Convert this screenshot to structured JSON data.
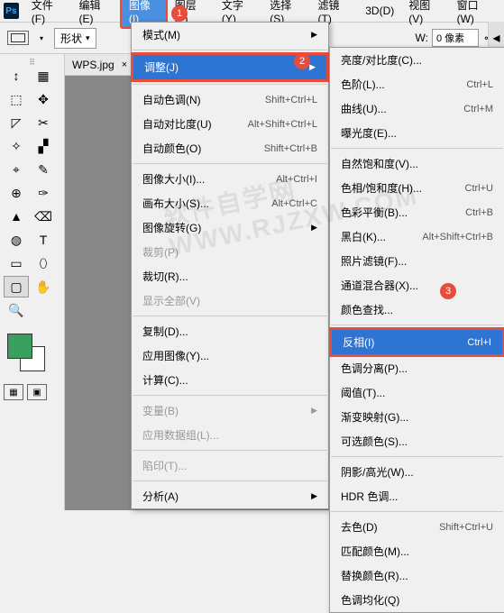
{
  "menubar": {
    "items": [
      "文件(F)",
      "编辑(E)",
      "图像(I)",
      "图层(L)",
      "文字(Y)",
      "选择(S)",
      "滤镜(T)",
      "3D(D)",
      "视图(V)",
      "窗口(W)"
    ],
    "active_index": 2
  },
  "optionbar": {
    "shape_label": "形状",
    "w_label": "W:",
    "w_value": "0 像素",
    "link": "⊶"
  },
  "tab": {
    "title": "WPS.jpg",
    "close": "×"
  },
  "badges": {
    "b1": "1",
    "b2": "2",
    "b3": "3"
  },
  "dropdown1": [
    {
      "label": "模式(M)",
      "arrow": true
    },
    {
      "sep": true
    },
    {
      "label": "调整(J)",
      "arrow": true,
      "selected": true,
      "highlighted": true
    },
    {
      "sep": true
    },
    {
      "label": "自动色调(N)",
      "shortcut": "Shift+Ctrl+L"
    },
    {
      "label": "自动对比度(U)",
      "shortcut": "Alt+Shift+Ctrl+L"
    },
    {
      "label": "自动颜色(O)",
      "shortcut": "Shift+Ctrl+B"
    },
    {
      "sep": true
    },
    {
      "label": "图像大小(I)...",
      "shortcut": "Alt+Ctrl+I"
    },
    {
      "label": "画布大小(S)...",
      "shortcut": "Alt+Ctrl+C"
    },
    {
      "label": "图像旋转(G)",
      "arrow": true
    },
    {
      "label": "裁剪(P)",
      "disabled": true
    },
    {
      "label": "裁切(R)..."
    },
    {
      "label": "显示全部(V)",
      "disabled": true
    },
    {
      "sep": true
    },
    {
      "label": "复制(D)..."
    },
    {
      "label": "应用图像(Y)..."
    },
    {
      "label": "计算(C)..."
    },
    {
      "sep": true
    },
    {
      "label": "变量(B)",
      "arrow": true,
      "disabled": true
    },
    {
      "label": "应用数据组(L)...",
      "disabled": true
    },
    {
      "sep": true
    },
    {
      "label": "陷印(T)...",
      "disabled": true
    },
    {
      "sep": true
    },
    {
      "label": "分析(A)",
      "arrow": true
    }
  ],
  "dropdown2": [
    {
      "label": "亮度/对比度(C)..."
    },
    {
      "label": "色阶(L)...",
      "shortcut": "Ctrl+L"
    },
    {
      "label": "曲线(U)...",
      "shortcut": "Ctrl+M"
    },
    {
      "label": "曝光度(E)..."
    },
    {
      "sep": true
    },
    {
      "label": "自然饱和度(V)..."
    },
    {
      "label": "色相/饱和度(H)...",
      "shortcut": "Ctrl+U"
    },
    {
      "label": "色彩平衡(B)...",
      "shortcut": "Ctrl+B"
    },
    {
      "label": "黑白(K)...",
      "shortcut": "Alt+Shift+Ctrl+B"
    },
    {
      "label": "照片滤镜(F)..."
    },
    {
      "label": "通道混合器(X)..."
    },
    {
      "label": "颜色查找..."
    },
    {
      "sep": true
    },
    {
      "label": "反相(I)",
      "shortcut": "Ctrl+I",
      "selected": true,
      "highlighted": true
    },
    {
      "label": "色调分离(P)..."
    },
    {
      "label": "阈值(T)..."
    },
    {
      "label": "渐变映射(G)..."
    },
    {
      "label": "可选颜色(S)..."
    },
    {
      "sep": true
    },
    {
      "label": "阴影/高光(W)..."
    },
    {
      "label": "HDR 色调..."
    },
    {
      "sep": true
    },
    {
      "label": "去色(D)",
      "shortcut": "Shift+Ctrl+U"
    },
    {
      "label": "匹配颜色(M)..."
    },
    {
      "label": "替换颜色(R)..."
    },
    {
      "label": "色调均化(Q)"
    }
  ],
  "tools": [
    "↕",
    "▦",
    "⬚",
    "✥",
    "◸",
    "✂",
    "✧",
    "▞",
    "⌖",
    "✎",
    "⊕",
    "✑",
    "▲",
    "⌫",
    "◍",
    "T",
    "▭",
    "⬯",
    "▢",
    "✋",
    "🔍"
  ],
  "watermark": "软件自学网 WWW.RJZXW.COM"
}
